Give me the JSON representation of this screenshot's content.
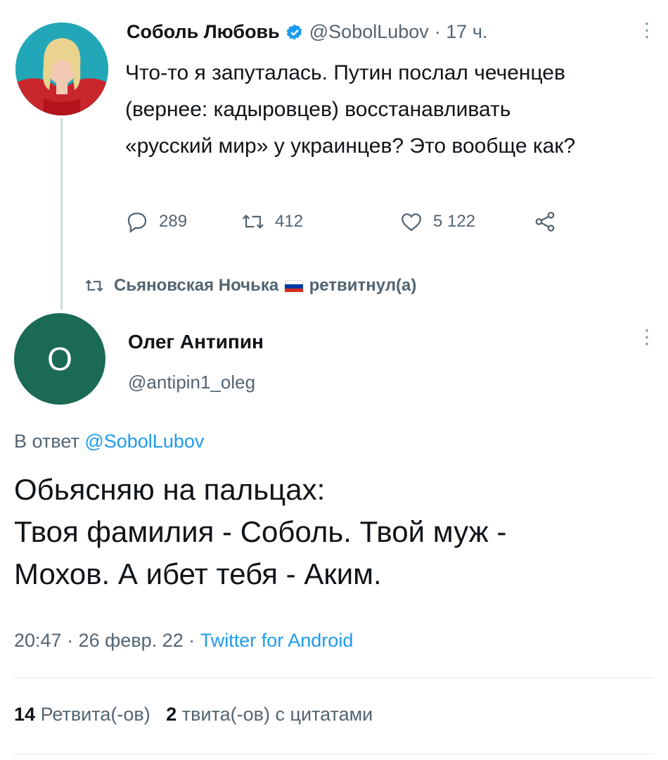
{
  "original": {
    "name": "Соболь Любовь",
    "handle": "@SobolLubov",
    "time": "· 17 ч.",
    "text": "Что-то я запуталась. Путин послал чеченцев (вернее: кадыровцев) восстанавливать «русский мир» у украинцев? Это вообще как?",
    "replies": "289",
    "retweets": "412",
    "likes": "5 122",
    "icons": [
      "verified-badge",
      "reply-icon",
      "retweet-icon",
      "like-icon",
      "share-icon",
      "more-icon"
    ]
  },
  "retweet_banner": {
    "user": "Сьяновская Ночька",
    "action": "ретвитнул(а)",
    "flag_colors": [
      "#ffffff",
      "#0039a6",
      "#d52b1e"
    ]
  },
  "reply": {
    "avatar_letter": "O",
    "name": "Олег Антипин",
    "handle": "@antipin1_oleg",
    "reply_prefix": "В ответ",
    "reply_mention": "@SobolLubov",
    "text_line1": "Обьясняю на пальцах:",
    "text_line2": "Твоя фамилия - Соболь. Твой муж -",
    "text_line3": "Мохов. А ибет тебя - Аким.",
    "timestamp": "20:47 · 26 февр. 22 ·",
    "source": "Twitter for Android",
    "retweets_count": "14",
    "retweets_label": "Ретвита(-ов)",
    "quotes_count": "2",
    "quotes_label": "твита(-ов) с цитатами"
  },
  "colors": {
    "accent": "#1d9bf0",
    "secondary_text": "#536471",
    "avatar_bg": "#1b6a55"
  }
}
